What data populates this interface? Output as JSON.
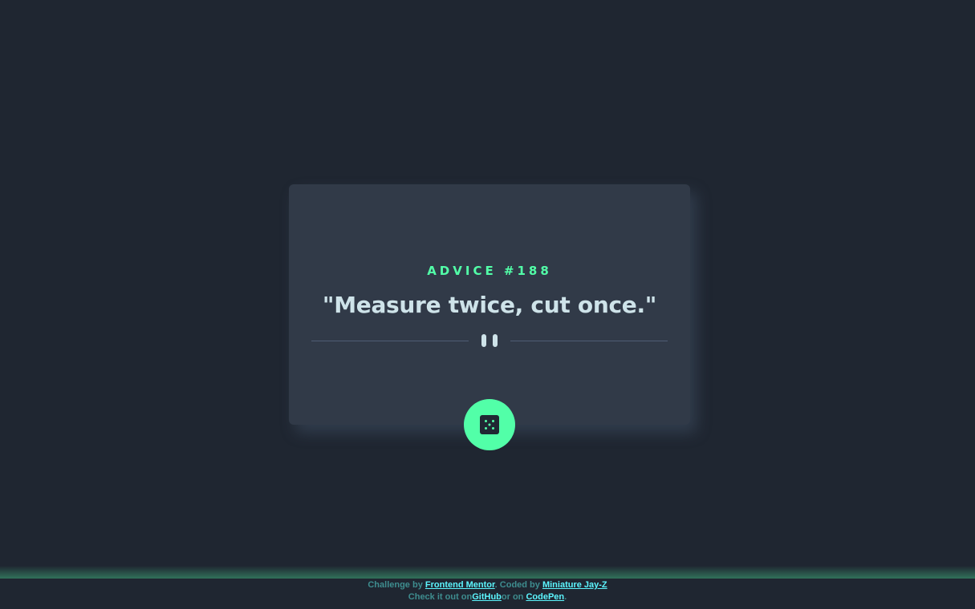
{
  "advice": {
    "label": "ADVICE #188",
    "text": "\"Measure twice, cut once.\""
  },
  "button": {
    "icon": "dice-icon"
  },
  "footer": {
    "line1_prefix": "Challenge by ",
    "challenge_link": "Frontend Mentor",
    "line1_middle": ". Coded by ",
    "author_link": "Miniature Jay-Z",
    "line2_prefix": "Check it out on",
    "github_link": "GitHub",
    "line2_middle": "or on ",
    "codepen_link": "CodePen",
    "line2_suffix": "."
  },
  "colors": {
    "background": "#1f2631",
    "card": "#313a48",
    "accent": "#52ffa8",
    "text": "#cee3e9",
    "link": "#5cf6ff"
  }
}
